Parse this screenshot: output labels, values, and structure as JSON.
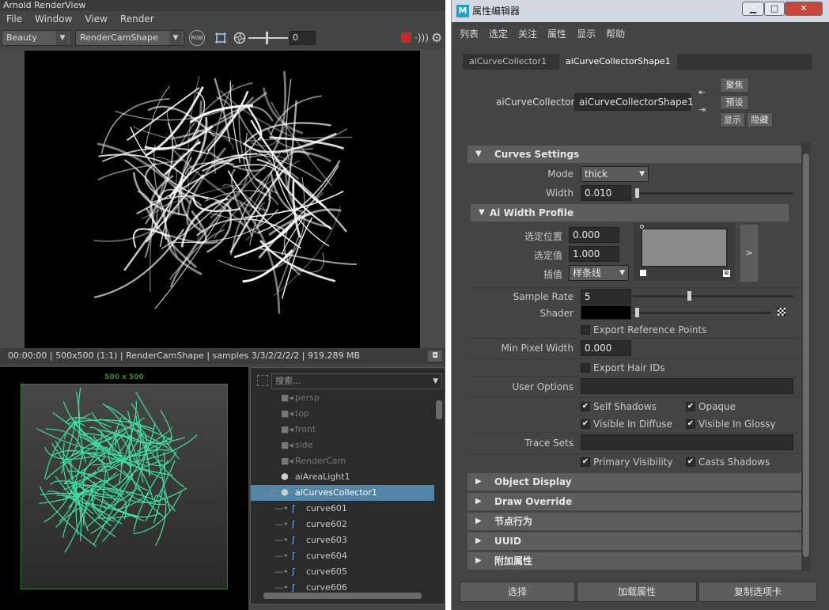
{
  "renderview": {
    "title": "Arnold RenderView",
    "menu": [
      "File",
      "Window",
      "View",
      "Render"
    ],
    "toolbar": {
      "aov": "Beauty",
      "camera": "RenderCamShape",
      "rgb_label": "RGB",
      "exposure_value": "0"
    },
    "status": "00:00:00 | 500x500 (1:1) | RenderCamShape  | samples 3/3/2/2/2/2 | 919.289 MB",
    "render_colors": {
      "background": "#000000",
      "hair": "#ffffff"
    }
  },
  "viewport": {
    "resolution": "500 x 500",
    "curve_color": "#3fe0a0"
  },
  "outliner": {
    "search_placeholder": "搜索...",
    "items": [
      {
        "label": "persp",
        "type": "camera",
        "dim": true
      },
      {
        "label": "top",
        "type": "camera",
        "dim": true
      },
      {
        "label": "front",
        "type": "camera",
        "dim": true
      },
      {
        "label": "side",
        "type": "camera",
        "dim": true
      },
      {
        "label": "RenderCam",
        "type": "camera",
        "dim": true
      },
      {
        "label": "aiAreaLight1",
        "type": "light",
        "dim": false
      },
      {
        "label": "aiCurvesCollector1",
        "type": "transform",
        "dim": false,
        "selected": true
      },
      {
        "label": "curve601",
        "type": "curve",
        "dim": false
      },
      {
        "label": "curve602",
        "type": "curve",
        "dim": false
      },
      {
        "label": "curve603",
        "type": "curve",
        "dim": false
      },
      {
        "label": "curve604",
        "type": "curve",
        "dim": false
      },
      {
        "label": "curve605",
        "type": "curve",
        "dim": false
      },
      {
        "label": "curve606",
        "type": "curve",
        "dim": false
      }
    ],
    "selection_color": "#5285a6"
  },
  "attribute_editor": {
    "title": "属性编辑器",
    "logo": "M",
    "menu": [
      "列表",
      "选定",
      "关注",
      "属性",
      "显示",
      "帮助"
    ],
    "tabs": [
      "aiCurveCollector1",
      "aiCurveCollectorShape1"
    ],
    "node_type_label": "aiCurveCollector:",
    "node_name": "aiCurveCollectorShape1",
    "buttons": {
      "focus": "聚焦",
      "presets": "预设",
      "show": "显示",
      "hide": "隐藏"
    },
    "curves_settings": {
      "header": "Curves Settings",
      "mode_label": "Mode",
      "mode_value": "thick",
      "width_label": "Width",
      "width_value": "0.010",
      "width_slider": 0.0
    },
    "width_profile": {
      "header": "Ai Width Profile",
      "position_label": "选定位置",
      "position_value": "0.000",
      "value_label": "选定值",
      "value_value": "1.000",
      "interp_label": "插值",
      "interp_value": "样条线",
      "expand_label": ">"
    },
    "sample_rate_label": "Sample Rate",
    "sample_rate_value": "5",
    "sample_rate_slider": 0.35,
    "shader_label": "Shader",
    "shader_color": "#000000",
    "export_ref_label": "Export Reference Points",
    "min_pixel_width_label": "Min Pixel Width",
    "min_pixel_width_value": "0.000",
    "export_hair_ids_label": "Export Hair IDs",
    "user_options_label": "User Options",
    "self_shadows_label": "Self Shadows",
    "opaque_label": "Opaque",
    "visible_diffuse_label": "Visible In Diffuse",
    "visible_glossy_label": "Visible In Glossy",
    "trace_sets_label": "Trace Sets",
    "primary_visibility_label": "Primary Visibility",
    "casts_shadows_label": "Casts Shadows",
    "collapsed_sections": [
      "Object Display",
      "Draw Override",
      "节点行为",
      "UUID",
      "附加属性"
    ],
    "bottom_buttons": [
      "选择",
      "加载属性",
      "复制选项卡"
    ]
  }
}
